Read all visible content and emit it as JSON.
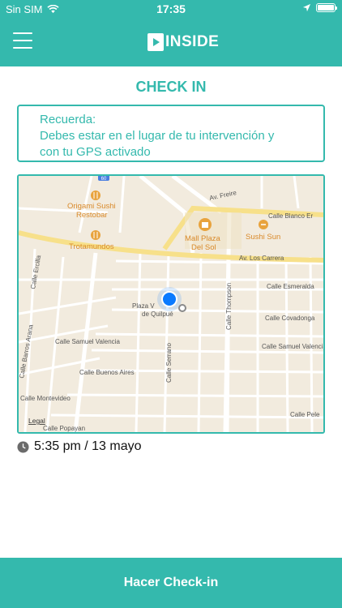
{
  "status_bar": {
    "carrier": "Sin SIM",
    "time": "17:35",
    "icons": [
      "wifi-icon",
      "location-arrow-icon",
      "battery-icon"
    ]
  },
  "header": {
    "menu_icon": "hamburger-menu-icon",
    "brand": "INSIDE",
    "background": "#34b9ad"
  },
  "page": {
    "title": "CHECK IN"
  },
  "reminder": {
    "heading": "Recuerda:",
    "line1": "Debes estar en el lugar de tu intervención y",
    "line2": "con tu GPS activado"
  },
  "map": {
    "labels": {
      "origami": "Origami Sushi",
      "restobar": "Restobar",
      "trotamundos": "Trotamundos",
      "mall1": "Mall Plaza",
      "mall2": "Del Sol",
      "sushi_sun": "Sushi Sun",
      "av_freire": "Av. Freire",
      "calle_blanco": "Calle Blanco Er",
      "av_los_carrera": "Av. Los Carrera",
      "calle_ercilla": "Calle Ercilla",
      "calle_esmeralda": "Calle Esmeralda",
      "plaza1": "Plaza V",
      "plaza2": "de Quilpué",
      "calle_thompson": "Calle Thompson",
      "calle_covadonga": "Calle Covadonga",
      "calle_barros": "Calle Barros Arana",
      "calle_samuel_left": "Calle Samuel Valencia",
      "calle_samuel_right": "Calle Samuel Valencia",
      "calle_serrano": "Calle Serrano",
      "calle_buenos_aires": "Calle Buenos Aires",
      "calle_montevideo": "Calle Montevideo",
      "calle_pele": "Calle Pele",
      "legal": "Legal",
      "calle_popayan": "Calle Popayan",
      "route_badge": "60"
    },
    "colors": {
      "land": "#f2ebde",
      "road": "#ffffff",
      "major_road": "#f7e08a",
      "poi": "#e8a33d",
      "location_dot": "#0a7aff"
    }
  },
  "timestamp": {
    "icon": "clock-icon",
    "text": "5:35 pm / 13 mayo"
  },
  "footer": {
    "checkin_label": "Hacer Check-in"
  }
}
